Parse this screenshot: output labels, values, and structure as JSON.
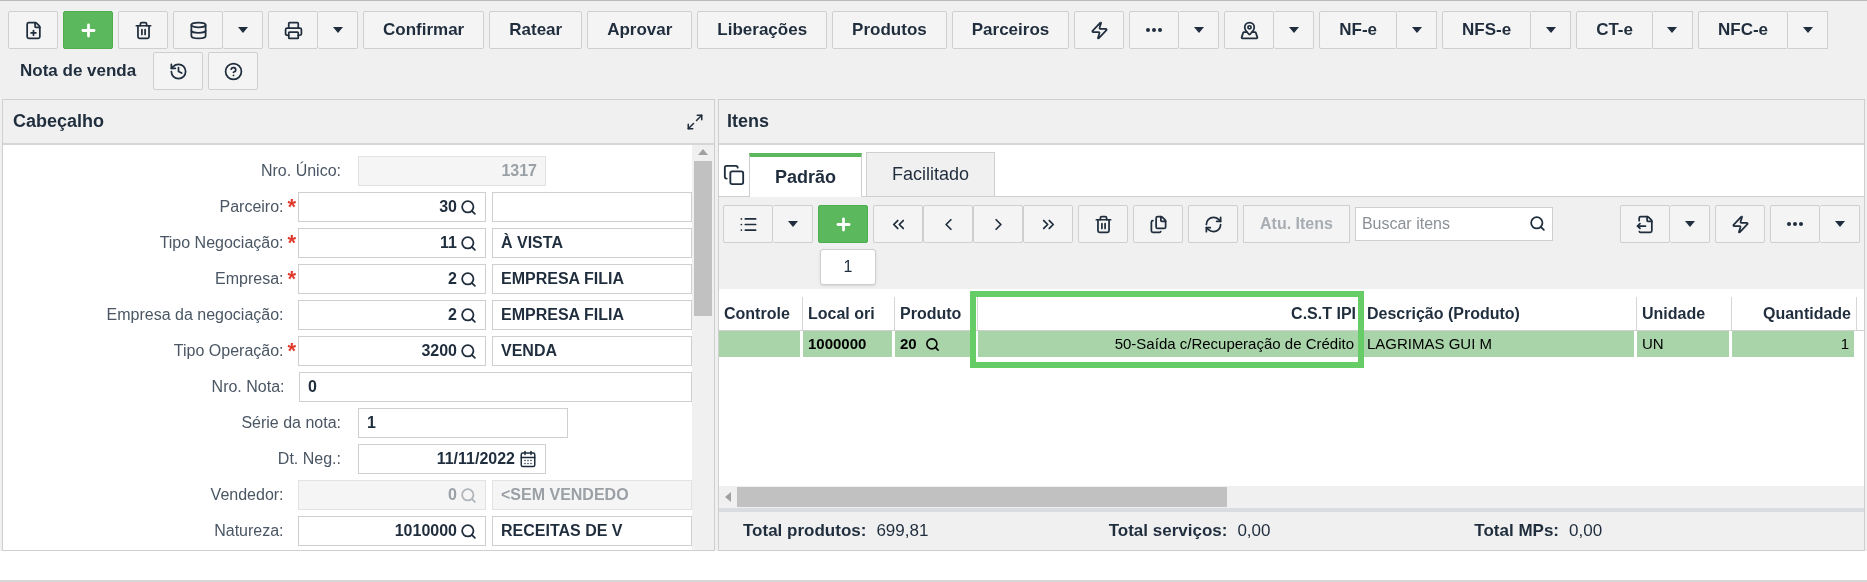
{
  "toolbar": {
    "actions": [
      "Confirmar",
      "Ratear",
      "Aprovar",
      "Liberações",
      "Produtos",
      "Parceiros"
    ],
    "documents": [
      {
        "label": "NF-e",
        "dropdown": true
      },
      {
        "label": "NFS-e",
        "dropdown": true
      },
      {
        "label": "CT-e",
        "dropdown": true
      },
      {
        "label": "NFC-e",
        "dropdown": true
      }
    ],
    "title": "Nota de venda"
  },
  "header_panel": {
    "title": "Cabeçalho",
    "fields": [
      {
        "kind": "number",
        "label": "Nro. Único:",
        "disabled": true,
        "value": "1317"
      },
      {
        "kind": "lookup",
        "label": "Parceiro:",
        "required_mark": "*",
        "disabled": false,
        "value": "30"
      },
      {
        "kind": "lookup",
        "label": "Tipo Negociação:",
        "required_mark": "*",
        "disabled": false,
        "value": "11",
        "description": "À VISTA"
      },
      {
        "kind": "lookup",
        "label": "Empresa:",
        "required_mark": "*",
        "disabled": false,
        "value": "2",
        "description": "EMPRESA FILIA"
      },
      {
        "kind": "lookup",
        "label": "Empresa da negociação:",
        "disabled": false,
        "value": "2",
        "description": "EMPRESA FILIA"
      },
      {
        "kind": "lookup",
        "label": "Tipo Operação:",
        "required_mark": "*",
        "disabled": false,
        "value": "3200",
        "description": "VENDA"
      },
      {
        "kind": "text",
        "label": "Nro. Nota:",
        "disabled": false,
        "value": "0"
      },
      {
        "kind": "short",
        "label": "Série da nota:",
        "disabled": false,
        "value": "1"
      },
      {
        "kind": "date",
        "label": "Dt. Neg.:",
        "disabled": false,
        "value": "11/11/2022"
      },
      {
        "kind": "lookup",
        "label": "Vendedor:",
        "disabled": true,
        "value": "0",
        "description": "<SEM VENDEDO"
      },
      {
        "kind": "lookup",
        "label": "Natureza:",
        "disabled": false,
        "value": "1010000",
        "description": "RECEITAS DE V"
      }
    ]
  },
  "items_panel": {
    "title": "Itens",
    "tabs": [
      {
        "label": "Padrão",
        "selected": true
      },
      {
        "label": "Facilitado",
        "selected": false
      }
    ],
    "update_button": {
      "label": "Atu. Itens",
      "disabled": true
    },
    "search": {
      "placeholder": "Buscar itens"
    },
    "tooltip": "1",
    "table": {
      "columns": [
        {
          "label": "Controle",
          "highlighted": false
        },
        {
          "label": "Local ori",
          "highlighted": false
        },
        {
          "label": "Produto",
          "highlighted": false
        },
        {
          "label": "C.S.T IPI",
          "highlighted": true
        },
        {
          "label": "Descrição (Produto)",
          "highlighted": false
        },
        {
          "label": "Unidade",
          "highlighted": false
        },
        {
          "label": "Quantidade",
          "highlighted": false
        }
      ],
      "rows": [
        {
          "selected": true,
          "cells": [
            "",
            "1000000",
            "20",
            "50-Saída c/Recuperação de Crédito",
            "LAGRIMAS GUI M",
            "UN",
            "1"
          ]
        }
      ]
    },
    "totals": [
      {
        "label": "Total produtos:",
        "value": "699,81"
      },
      {
        "label": "Total serviços:",
        "value": "0,00"
      },
      {
        "label": "Total MPs:",
        "value": "0,00"
      }
    ]
  }
}
